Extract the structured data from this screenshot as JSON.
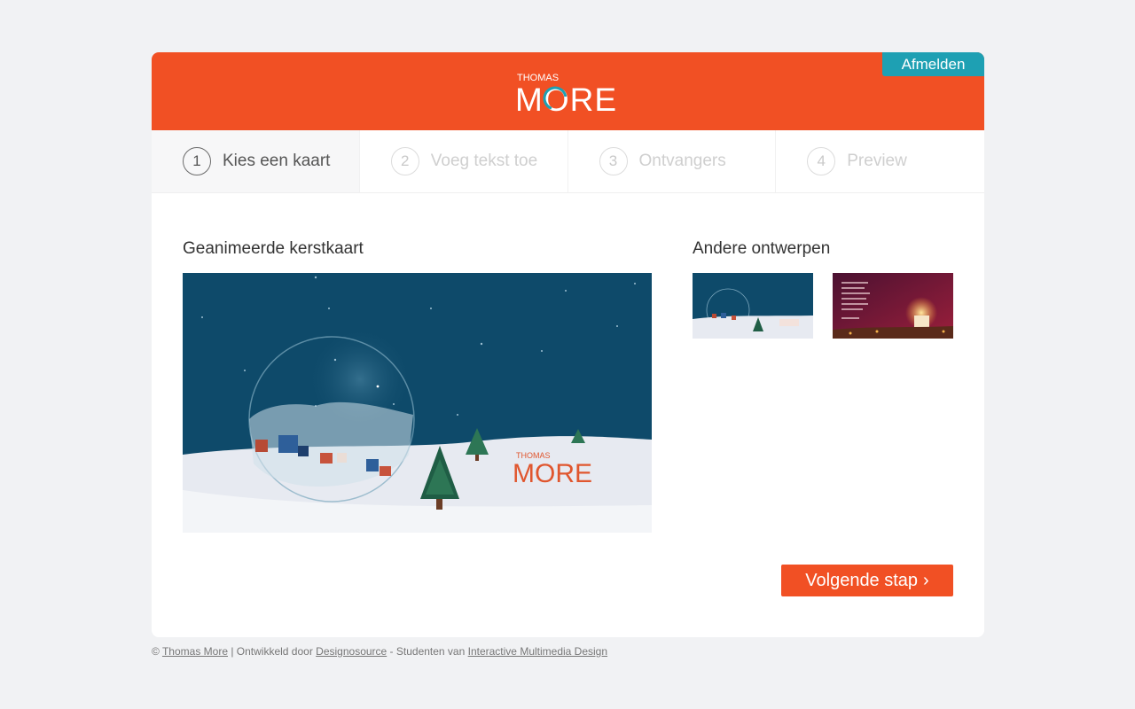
{
  "header": {
    "logout_label": "Afmelden",
    "logo_top": "THOMAS",
    "logo_bottom": "MORE"
  },
  "steps": [
    {
      "num": "1",
      "label": "Kies een kaart",
      "active": true
    },
    {
      "num": "2",
      "label": "Voeg tekst toe",
      "active": false
    },
    {
      "num": "3",
      "label": "Ontvangers",
      "active": false
    },
    {
      "num": "4",
      "label": "Preview",
      "active": false
    }
  ],
  "main": {
    "title": "Geanimeerde kerstkaart",
    "card_logo_top": "THOMAS",
    "card_logo_bottom": "MORE"
  },
  "other": {
    "title": "Andere ontwerpen"
  },
  "next_button": {
    "label": "Volgende stap",
    "icon": "chevron-right-icon"
  },
  "footer": {
    "copyright": "©",
    "link1": "Thomas More",
    "sep1": " | Ontwikkeld door ",
    "link2": "Designosource",
    "sep2": " - Studenten van ",
    "link3": "Interactive Multimedia Design"
  },
  "colors": {
    "brand_orange": "#f15024",
    "accent_teal": "#1ea0b3",
    "night_sky": "#0e4a6a"
  }
}
